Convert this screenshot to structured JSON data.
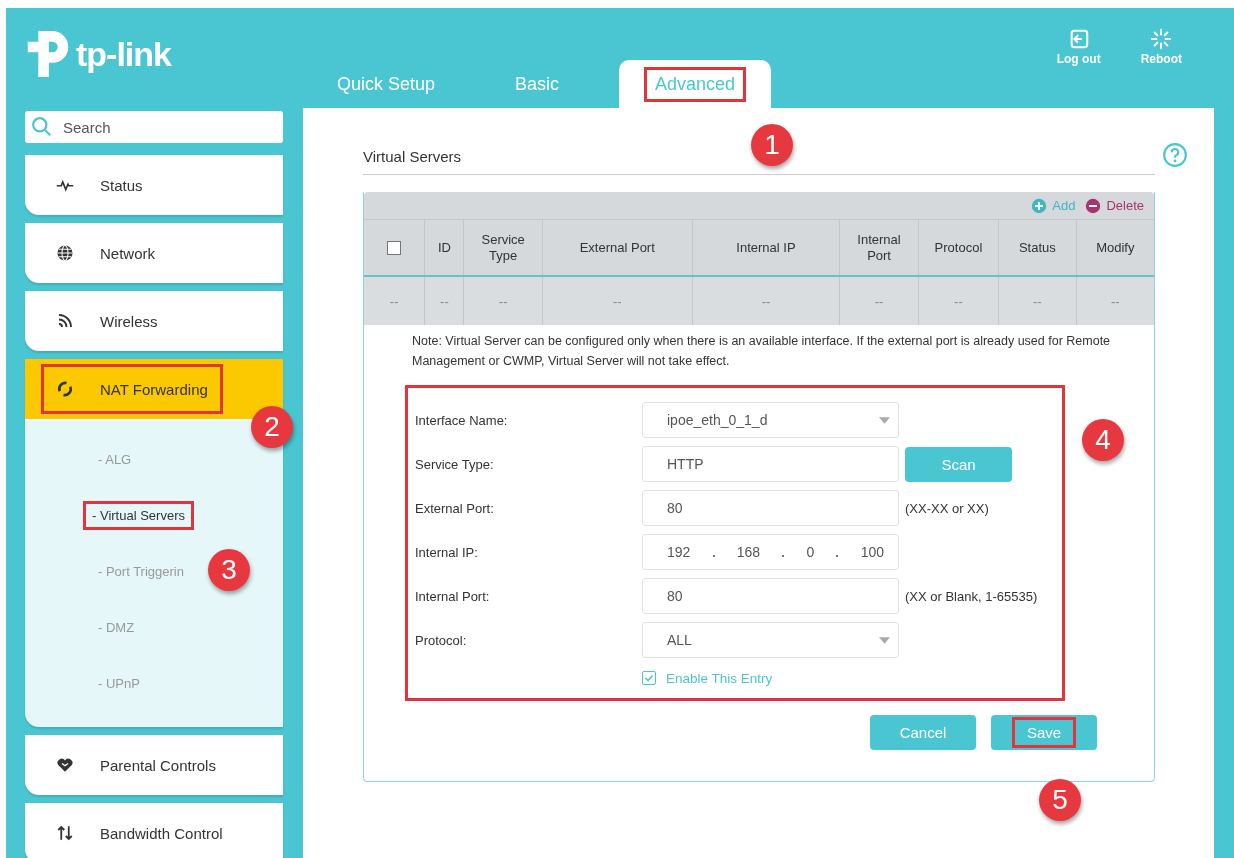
{
  "logo": {
    "text": "tp-link"
  },
  "tabs": [
    {
      "label": "Quick Setup",
      "selected": false,
      "highlighted": false
    },
    {
      "label": "Basic",
      "selected": false,
      "highlighted": false
    },
    {
      "label": "Advanced",
      "selected": true,
      "highlighted": true
    }
  ],
  "header_actions": [
    {
      "kind": "logout",
      "label": "Log out"
    },
    {
      "kind": "reboot",
      "label": "Reboot"
    }
  ],
  "sidebar": {
    "search": {
      "placeholder": "Search"
    },
    "items": [
      {
        "kind": "status",
        "label": "Status",
        "selected": false,
        "highlighted": false
      },
      {
        "kind": "network",
        "label": "Network",
        "selected": false,
        "highlighted": false
      },
      {
        "kind": "wireless",
        "label": "Wireless",
        "selected": false,
        "highlighted": false
      },
      {
        "kind": "nat",
        "label": "NAT Forwarding",
        "selected": true,
        "highlighted": true,
        "children": [
          {
            "label": "- ALG",
            "selected": false,
            "highlighted": false
          },
          {
            "label": "- Virtual Servers",
            "selected": true,
            "highlighted": true
          },
          {
            "label": "- Port Triggerin",
            "selected": false,
            "highlighted": false
          },
          {
            "label": "- DMZ",
            "selected": false,
            "highlighted": false
          },
          {
            "label": "- UPnP",
            "selected": false,
            "highlighted": false
          }
        ]
      },
      {
        "kind": "parental",
        "label": "Parental Controls",
        "selected": false,
        "highlighted": false
      },
      {
        "kind": "bandwidth",
        "label": "Bandwidth Control",
        "selected": false,
        "highlighted": false
      }
    ]
  },
  "page": {
    "title": "Virtual Servers"
  },
  "table": {
    "toolbar": [
      {
        "kind": "add",
        "label": "Add"
      },
      {
        "kind": "delete",
        "label": "Delete"
      }
    ],
    "columns": [
      {
        "kind": "checkbox",
        "checked": false
      },
      {
        "kind": "text",
        "label": "ID"
      },
      {
        "kind": "text",
        "label": "Service Type"
      },
      {
        "kind": "text",
        "label": "External Port"
      },
      {
        "kind": "text",
        "label": "Internal IP"
      },
      {
        "kind": "text",
        "label": "Internal Port"
      },
      {
        "kind": "text",
        "label": "Protocol"
      },
      {
        "kind": "text",
        "label": "Status"
      },
      {
        "kind": "text",
        "label": "Modify"
      }
    ],
    "rows": [
      [
        "--",
        "--",
        "--",
        "--",
        "--",
        "--",
        "--",
        "--",
        "--"
      ]
    ]
  },
  "note": "Note: Virtual Server can be configured only when there is an available interface. If the external port is already used for Remote Management or CWMP, Virtual Server will not take effect.",
  "form": {
    "highlighted": true,
    "fields": [
      {
        "kind": "select",
        "label": "Interface Name:",
        "value": "ipoe_eth_0_1_d"
      },
      {
        "kind": "text",
        "label": "Service Type:",
        "value": "HTTP",
        "button": "Scan"
      },
      {
        "kind": "text",
        "label": "External Port:",
        "value": "80",
        "hint": "(XX-XX or XX)"
      },
      {
        "kind": "ip",
        "label": "Internal IP:",
        "octets": [
          "192",
          "168",
          "0",
          "100"
        ]
      },
      {
        "kind": "text",
        "label": "Internal Port:",
        "value": "80",
        "hint": "(XX or Blank, 1-65535)"
      },
      {
        "kind": "select",
        "label": "Protocol:",
        "value": "ALL"
      }
    ],
    "enable": {
      "label": "Enable This Entry",
      "checked": true
    }
  },
  "buttons": [
    {
      "label": "Cancel",
      "highlighted": false
    },
    {
      "label": "Save",
      "highlighted": true
    }
  ],
  "callouts": [
    "1",
    "2",
    "3",
    "4",
    "5"
  ]
}
